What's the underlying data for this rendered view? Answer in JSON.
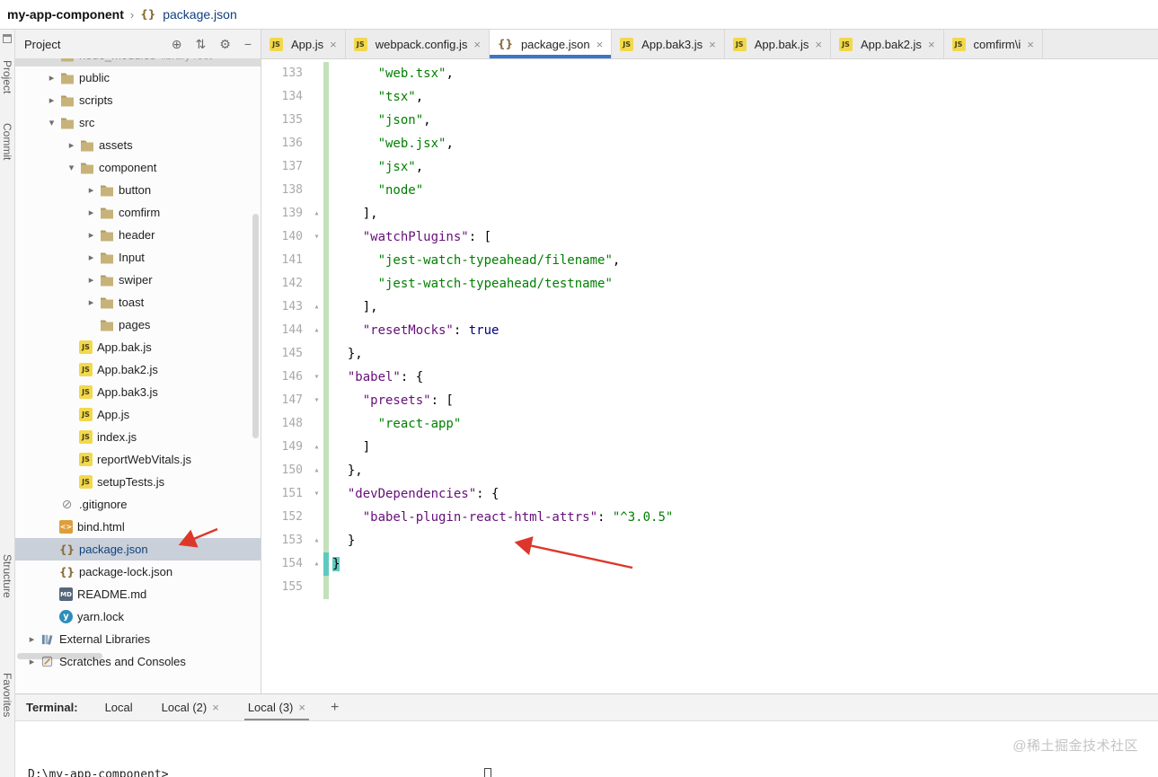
{
  "colors": {
    "accent": "#3D76C4",
    "str": "#008000",
    "key": "#660E7A",
    "kw": "#000080",
    "change": "#C3E1BA",
    "sel": "#C9D0DA",
    "red": "#DD372B",
    "teal": "#5FC9BF"
  },
  "icons": {
    "locate": "⊕",
    "collapse": "⇅",
    "settings": "⚙",
    "hide": "−",
    "close": "×",
    "add": "+",
    "chevron_right": "▸",
    "chevron_down": "▾"
  },
  "breadcrumb": {
    "project": "my-app-component",
    "separator": "›",
    "file": "package.json"
  },
  "left_strip": {
    "labels": [
      "Project",
      "Commit",
      "Structure",
      "Favorites"
    ]
  },
  "project_panel": {
    "title": "Project"
  },
  "editor_tabs": [
    {
      "label": "App.js",
      "icon": "js"
    },
    {
      "label": "webpack.config.js",
      "icon": "js"
    },
    {
      "label": "package.json",
      "icon": "json",
      "active": true
    },
    {
      "label": "App.bak3.js",
      "icon": "js"
    },
    {
      "label": "App.bak.js",
      "icon": "js"
    },
    {
      "label": "App.bak2.js",
      "icon": "js"
    },
    {
      "label": "comfirm\\i",
      "icon": "js"
    }
  ],
  "tree": [
    {
      "label": "node_modules",
      "annotation": "library root",
      "icon": "folder",
      "indent": 1,
      "chevron": "",
      "ghost": true
    },
    {
      "label": "public",
      "icon": "folder",
      "indent": 1,
      "chevron": "right"
    },
    {
      "label": "scripts",
      "icon": "folder",
      "indent": 1,
      "chevron": "right"
    },
    {
      "label": "src",
      "icon": "folder",
      "indent": 1,
      "chevron": "down"
    },
    {
      "label": "assets",
      "icon": "folder",
      "indent": 2,
      "chevron": "right"
    },
    {
      "label": "component",
      "icon": "folder",
      "indent": 2,
      "chevron": "down"
    },
    {
      "label": "button",
      "icon": "folder",
      "indent": 3,
      "chevron": "right"
    },
    {
      "label": "comfirm",
      "icon": "folder",
      "indent": 3,
      "chevron": "right"
    },
    {
      "label": "header",
      "icon": "folder",
      "indent": 3,
      "chevron": "right"
    },
    {
      "label": "Input",
      "icon": "folder",
      "indent": 3,
      "chevron": "right"
    },
    {
      "label": "swiper",
      "icon": "folder",
      "indent": 3,
      "chevron": "right"
    },
    {
      "label": "toast",
      "icon": "folder",
      "indent": 3,
      "chevron": "right"
    },
    {
      "label": "pages",
      "icon": "folder",
      "indent": 3,
      "chevron": ""
    },
    {
      "label": "App.bak.js",
      "icon": "js",
      "indent": 2,
      "chevron": ""
    },
    {
      "label": "App.bak2.js",
      "icon": "js",
      "indent": 2,
      "chevron": ""
    },
    {
      "label": "App.bak3.js",
      "icon": "js",
      "indent": 2,
      "chevron": ""
    },
    {
      "label": "App.js",
      "icon": "js",
      "indent": 2,
      "chevron": ""
    },
    {
      "label": "index.js",
      "icon": "js",
      "indent": 2,
      "chevron": ""
    },
    {
      "label": "reportWebVitals.js",
      "icon": "js",
      "indent": 2,
      "chevron": ""
    },
    {
      "label": "setupTests.js",
      "icon": "js",
      "indent": 2,
      "chevron": ""
    },
    {
      "label": ".gitignore",
      "icon": "ignore",
      "indent": 1,
      "chevron": ""
    },
    {
      "label": "bind.html",
      "icon": "html",
      "indent": 1,
      "chevron": ""
    },
    {
      "label": "package.json",
      "icon": "json",
      "indent": 1,
      "chevron": "",
      "selected": true
    },
    {
      "label": "package-lock.json",
      "icon": "json",
      "indent": 1,
      "chevron": ""
    },
    {
      "label": "README.md",
      "icon": "md",
      "indent": 1,
      "chevron": ""
    },
    {
      "label": "yarn.lock",
      "icon": "yarn",
      "indent": 1,
      "chevron": ""
    },
    {
      "label": "External Libraries",
      "icon": "libs",
      "indent": 0,
      "chevron": "right"
    },
    {
      "label": "Scratches and Consoles",
      "icon": "scratch",
      "indent": 0,
      "chevron": "right"
    }
  ],
  "editor": {
    "lines": [
      {
        "num": 133,
        "indent": 6,
        "segs": [
          {
            "c": "str",
            "t": "\"web.tsx\""
          },
          {
            "c": "pln",
            "t": ","
          }
        ]
      },
      {
        "num": 134,
        "indent": 6,
        "segs": [
          {
            "c": "str",
            "t": "\"tsx\""
          },
          {
            "c": "pln",
            "t": ","
          }
        ]
      },
      {
        "num": 135,
        "indent": 6,
        "segs": [
          {
            "c": "str",
            "t": "\"json\""
          },
          {
            "c": "pln",
            "t": ","
          }
        ]
      },
      {
        "num": 136,
        "indent": 6,
        "segs": [
          {
            "c": "str",
            "t": "\"web.jsx\""
          },
          {
            "c": "pln",
            "t": ","
          }
        ]
      },
      {
        "num": 137,
        "indent": 6,
        "segs": [
          {
            "c": "str",
            "t": "\"jsx\""
          },
          {
            "c": "pln",
            "t": ","
          }
        ]
      },
      {
        "num": 138,
        "indent": 6,
        "segs": [
          {
            "c": "str",
            "t": "\"node\""
          }
        ]
      },
      {
        "num": 139,
        "indent": 4,
        "fold": "end",
        "segs": [
          {
            "c": "pln",
            "t": "],"
          }
        ]
      },
      {
        "num": 140,
        "indent": 4,
        "fold": "open",
        "segs": [
          {
            "c": "key",
            "t": "\"watchPlugins\""
          },
          {
            "c": "pln",
            "t": ": ["
          }
        ]
      },
      {
        "num": 141,
        "indent": 6,
        "segs": [
          {
            "c": "str",
            "t": "\"jest-watch-typeahead/filename\""
          },
          {
            "c": "pln",
            "t": ","
          }
        ]
      },
      {
        "num": 142,
        "indent": 6,
        "segs": [
          {
            "c": "str",
            "t": "\"jest-watch-typeahead/testname\""
          }
        ]
      },
      {
        "num": 143,
        "indent": 4,
        "fold": "end",
        "segs": [
          {
            "c": "pln",
            "t": "],"
          }
        ]
      },
      {
        "num": 144,
        "indent": 4,
        "fold": "end",
        "segs": [
          {
            "c": "key",
            "t": "\"resetMocks\""
          },
          {
            "c": "pln",
            "t": ": "
          },
          {
            "c": "kw",
            "t": "true"
          }
        ]
      },
      {
        "num": 145,
        "indent": 2,
        "segs": [
          {
            "c": "pln",
            "t": "},"
          }
        ]
      },
      {
        "num": 146,
        "indent": 2,
        "fold": "open",
        "segs": [
          {
            "c": "key",
            "t": "\"babel\""
          },
          {
            "c": "pln",
            "t": ": {"
          }
        ]
      },
      {
        "num": 147,
        "indent": 4,
        "fold": "open",
        "segs": [
          {
            "c": "key",
            "t": "\"presets\""
          },
          {
            "c": "pln",
            "t": ": ["
          }
        ]
      },
      {
        "num": 148,
        "indent": 6,
        "segs": [
          {
            "c": "str",
            "t": "\"react-app\""
          }
        ]
      },
      {
        "num": 149,
        "indent": 4,
        "fold": "end",
        "segs": [
          {
            "c": "pln",
            "t": "]"
          }
        ]
      },
      {
        "num": 150,
        "indent": 2,
        "fold": "end",
        "segs": [
          {
            "c": "pln",
            "t": "},"
          }
        ]
      },
      {
        "num": 151,
        "indent": 2,
        "fold": "open",
        "segs": [
          {
            "c": "key",
            "t": "\"devDependencies\""
          },
          {
            "c": "pln",
            "t": ": {"
          }
        ]
      },
      {
        "num": 152,
        "indent": 4,
        "segs": [
          {
            "c": "key",
            "t": "\"babel-plugin-react-html-attrs\""
          },
          {
            "c": "pln",
            "t": ": "
          },
          {
            "c": "str",
            "t": "\"^3.0.5\""
          }
        ]
      },
      {
        "num": 153,
        "indent": 2,
        "fold": "end",
        "segs": [
          {
            "c": "pln",
            "t": "}"
          }
        ]
      },
      {
        "num": 154,
        "indent": 0,
        "fold": "end",
        "caret": true,
        "segs": [
          {
            "c": "brace",
            "t": "}"
          }
        ]
      },
      {
        "num": 155,
        "indent": 0,
        "segs": []
      }
    ]
  },
  "terminal": {
    "label": "Terminal:",
    "prompt": "D:\\my-app-component>",
    "tabs": [
      {
        "label": "Local"
      },
      {
        "label": "Local (2)",
        "closable": true
      },
      {
        "label": "Local (3)",
        "closable": true,
        "active": true
      }
    ]
  },
  "watermark": "@稀土掘金技术社区"
}
